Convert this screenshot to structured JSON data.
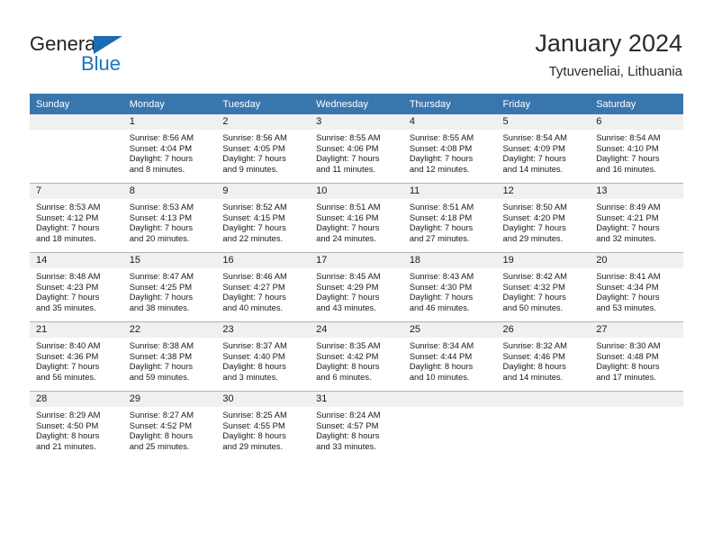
{
  "brand": {
    "name_top": "General",
    "name_bottom": "Blue",
    "logo_icon": "triangle-flag-icon"
  },
  "header": {
    "title": "January 2024",
    "subtitle": "Tytuveneliai, Lithuania"
  },
  "colors": {
    "header_row": "#3a76ae",
    "brand_blue": "#1b75bb",
    "daynum_band": "#f0f0f0",
    "grid_line": "#b3b3b3",
    "text": "#1a1a1a"
  },
  "calendar": {
    "weekday_headers": [
      "Sunday",
      "Monday",
      "Tuesday",
      "Wednesday",
      "Thursday",
      "Friday",
      "Saturday"
    ],
    "weeks": [
      [
        {
          "day": "",
          "sunrise": "",
          "sunset": "",
          "daylight_line1": "",
          "daylight_line2": ""
        },
        {
          "day": "1",
          "sunrise": "Sunrise: 8:56 AM",
          "sunset": "Sunset: 4:04 PM",
          "daylight_line1": "Daylight: 7 hours",
          "daylight_line2": "and 8 minutes."
        },
        {
          "day": "2",
          "sunrise": "Sunrise: 8:56 AM",
          "sunset": "Sunset: 4:05 PM",
          "daylight_line1": "Daylight: 7 hours",
          "daylight_line2": "and 9 minutes."
        },
        {
          "day": "3",
          "sunrise": "Sunrise: 8:55 AM",
          "sunset": "Sunset: 4:06 PM",
          "daylight_line1": "Daylight: 7 hours",
          "daylight_line2": "and 11 minutes."
        },
        {
          "day": "4",
          "sunrise": "Sunrise: 8:55 AM",
          "sunset": "Sunset: 4:08 PM",
          "daylight_line1": "Daylight: 7 hours",
          "daylight_line2": "and 12 minutes."
        },
        {
          "day": "5",
          "sunrise": "Sunrise: 8:54 AM",
          "sunset": "Sunset: 4:09 PM",
          "daylight_line1": "Daylight: 7 hours",
          "daylight_line2": "and 14 minutes."
        },
        {
          "day": "6",
          "sunrise": "Sunrise: 8:54 AM",
          "sunset": "Sunset: 4:10 PM",
          "daylight_line1": "Daylight: 7 hours",
          "daylight_line2": "and 16 minutes."
        }
      ],
      [
        {
          "day": "7",
          "sunrise": "Sunrise: 8:53 AM",
          "sunset": "Sunset: 4:12 PM",
          "daylight_line1": "Daylight: 7 hours",
          "daylight_line2": "and 18 minutes."
        },
        {
          "day": "8",
          "sunrise": "Sunrise: 8:53 AM",
          "sunset": "Sunset: 4:13 PM",
          "daylight_line1": "Daylight: 7 hours",
          "daylight_line2": "and 20 minutes."
        },
        {
          "day": "9",
          "sunrise": "Sunrise: 8:52 AM",
          "sunset": "Sunset: 4:15 PM",
          "daylight_line1": "Daylight: 7 hours",
          "daylight_line2": "and 22 minutes."
        },
        {
          "day": "10",
          "sunrise": "Sunrise: 8:51 AM",
          "sunset": "Sunset: 4:16 PM",
          "daylight_line1": "Daylight: 7 hours",
          "daylight_line2": "and 24 minutes."
        },
        {
          "day": "11",
          "sunrise": "Sunrise: 8:51 AM",
          "sunset": "Sunset: 4:18 PM",
          "daylight_line1": "Daylight: 7 hours",
          "daylight_line2": "and 27 minutes."
        },
        {
          "day": "12",
          "sunrise": "Sunrise: 8:50 AM",
          "sunset": "Sunset: 4:20 PM",
          "daylight_line1": "Daylight: 7 hours",
          "daylight_line2": "and 29 minutes."
        },
        {
          "day": "13",
          "sunrise": "Sunrise: 8:49 AM",
          "sunset": "Sunset: 4:21 PM",
          "daylight_line1": "Daylight: 7 hours",
          "daylight_line2": "and 32 minutes."
        }
      ],
      [
        {
          "day": "14",
          "sunrise": "Sunrise: 8:48 AM",
          "sunset": "Sunset: 4:23 PM",
          "daylight_line1": "Daylight: 7 hours",
          "daylight_line2": "and 35 minutes."
        },
        {
          "day": "15",
          "sunrise": "Sunrise: 8:47 AM",
          "sunset": "Sunset: 4:25 PM",
          "daylight_line1": "Daylight: 7 hours",
          "daylight_line2": "and 38 minutes."
        },
        {
          "day": "16",
          "sunrise": "Sunrise: 8:46 AM",
          "sunset": "Sunset: 4:27 PM",
          "daylight_line1": "Daylight: 7 hours",
          "daylight_line2": "and 40 minutes."
        },
        {
          "day": "17",
          "sunrise": "Sunrise: 8:45 AM",
          "sunset": "Sunset: 4:29 PM",
          "daylight_line1": "Daylight: 7 hours",
          "daylight_line2": "and 43 minutes."
        },
        {
          "day": "18",
          "sunrise": "Sunrise: 8:43 AM",
          "sunset": "Sunset: 4:30 PM",
          "daylight_line1": "Daylight: 7 hours",
          "daylight_line2": "and 46 minutes."
        },
        {
          "day": "19",
          "sunrise": "Sunrise: 8:42 AM",
          "sunset": "Sunset: 4:32 PM",
          "daylight_line1": "Daylight: 7 hours",
          "daylight_line2": "and 50 minutes."
        },
        {
          "day": "20",
          "sunrise": "Sunrise: 8:41 AM",
          "sunset": "Sunset: 4:34 PM",
          "daylight_line1": "Daylight: 7 hours",
          "daylight_line2": "and 53 minutes."
        }
      ],
      [
        {
          "day": "21",
          "sunrise": "Sunrise: 8:40 AM",
          "sunset": "Sunset: 4:36 PM",
          "daylight_line1": "Daylight: 7 hours",
          "daylight_line2": "and 56 minutes."
        },
        {
          "day": "22",
          "sunrise": "Sunrise: 8:38 AM",
          "sunset": "Sunset: 4:38 PM",
          "daylight_line1": "Daylight: 7 hours",
          "daylight_line2": "and 59 minutes."
        },
        {
          "day": "23",
          "sunrise": "Sunrise: 8:37 AM",
          "sunset": "Sunset: 4:40 PM",
          "daylight_line1": "Daylight: 8 hours",
          "daylight_line2": "and 3 minutes."
        },
        {
          "day": "24",
          "sunrise": "Sunrise: 8:35 AM",
          "sunset": "Sunset: 4:42 PM",
          "daylight_line1": "Daylight: 8 hours",
          "daylight_line2": "and 6 minutes."
        },
        {
          "day": "25",
          "sunrise": "Sunrise: 8:34 AM",
          "sunset": "Sunset: 4:44 PM",
          "daylight_line1": "Daylight: 8 hours",
          "daylight_line2": "and 10 minutes."
        },
        {
          "day": "26",
          "sunrise": "Sunrise: 8:32 AM",
          "sunset": "Sunset: 4:46 PM",
          "daylight_line1": "Daylight: 8 hours",
          "daylight_line2": "and 14 minutes."
        },
        {
          "day": "27",
          "sunrise": "Sunrise: 8:30 AM",
          "sunset": "Sunset: 4:48 PM",
          "daylight_line1": "Daylight: 8 hours",
          "daylight_line2": "and 17 minutes."
        }
      ],
      [
        {
          "day": "28",
          "sunrise": "Sunrise: 8:29 AM",
          "sunset": "Sunset: 4:50 PM",
          "daylight_line1": "Daylight: 8 hours",
          "daylight_line2": "and 21 minutes."
        },
        {
          "day": "29",
          "sunrise": "Sunrise: 8:27 AM",
          "sunset": "Sunset: 4:52 PM",
          "daylight_line1": "Daylight: 8 hours",
          "daylight_line2": "and 25 minutes."
        },
        {
          "day": "30",
          "sunrise": "Sunrise: 8:25 AM",
          "sunset": "Sunset: 4:55 PM",
          "daylight_line1": "Daylight: 8 hours",
          "daylight_line2": "and 29 minutes."
        },
        {
          "day": "31",
          "sunrise": "Sunrise: 8:24 AM",
          "sunset": "Sunset: 4:57 PM",
          "daylight_line1": "Daylight: 8 hours",
          "daylight_line2": "and 33 minutes."
        },
        {
          "day": "",
          "sunrise": "",
          "sunset": "",
          "daylight_line1": "",
          "daylight_line2": ""
        },
        {
          "day": "",
          "sunrise": "",
          "sunset": "",
          "daylight_line1": "",
          "daylight_line2": ""
        },
        {
          "day": "",
          "sunrise": "",
          "sunset": "",
          "daylight_line1": "",
          "daylight_line2": ""
        }
      ]
    ]
  }
}
